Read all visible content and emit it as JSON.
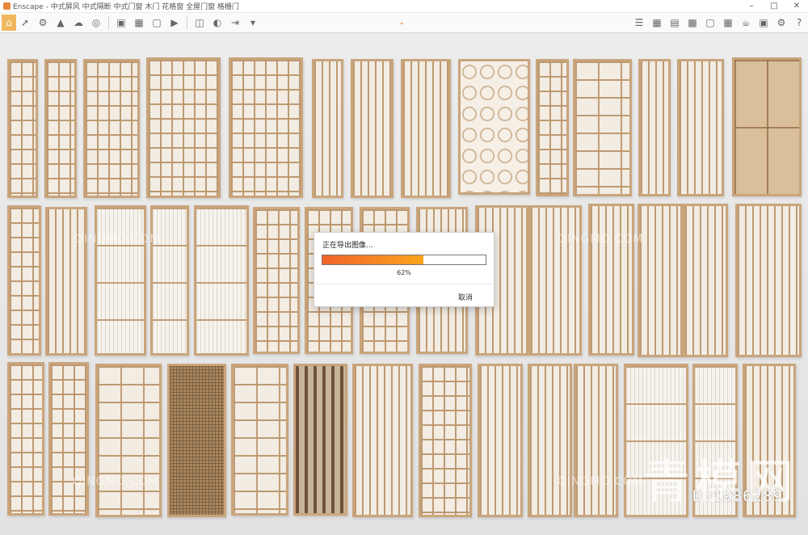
{
  "window": {
    "app_name": "Enscape",
    "title": "Enscape - 中式屏风 中式隔断 中式门窗 木门 花格窗 全屋门窗 格栅门",
    "controls": [
      "minimize-icon",
      "maximize-icon",
      "close-icon"
    ]
  },
  "toolbar": {
    "left_tools": [
      "home-icon",
      "cursor-icon",
      "asset-icon",
      "mountain-icon",
      "cloud-icon",
      "sky-icon",
      "cube-icon",
      "save-view-icon",
      "screenshot-icon",
      "video-icon",
      "panorama-icon",
      "render-icon",
      "export-icon",
      "settings-icon"
    ],
    "right_tools": [
      "list-icon",
      "grid-icon",
      "monitor-icon",
      "display-icon",
      "box-icon",
      "library-icon",
      "cup-icon",
      "vr-icon",
      "settings-gear-icon",
      "help-icon"
    ]
  },
  "dialog": {
    "title": "正在导出图像...",
    "progress": 0.62,
    "percent_text": "62%",
    "cancel_label": "取消"
  },
  "watermark": {
    "logo_text": "QINGMO.COM",
    "big_text": "青模网",
    "id_text": "D:1986289"
  },
  "colors": {
    "accent": "#f09a2a",
    "panel_wood": "#c9a57c",
    "progress_start": "#f0632a",
    "progress_end": "#f9a51d"
  }
}
